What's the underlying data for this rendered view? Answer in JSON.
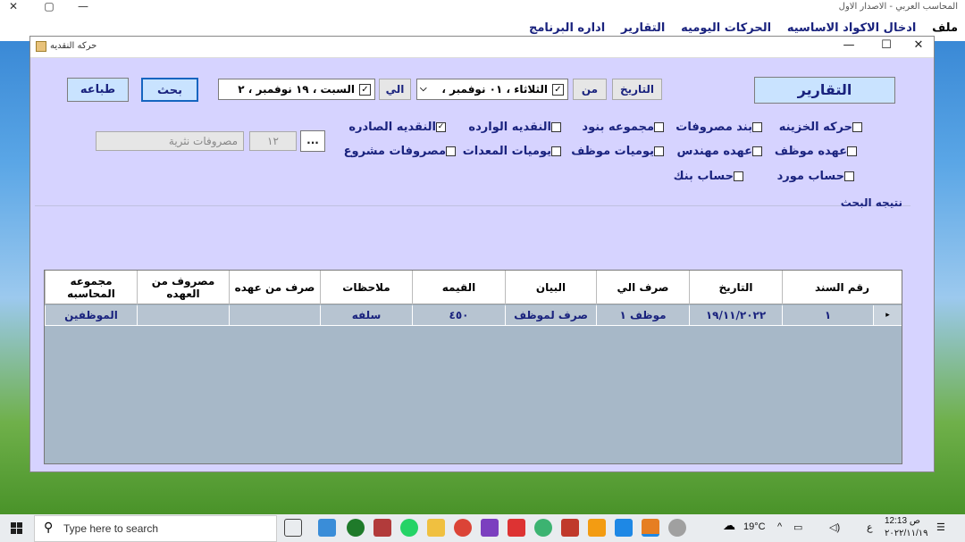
{
  "app": {
    "title": "المحاسب العربي - الاصدار الاول",
    "window_controls": {
      "minimize": "—",
      "maximize": "▢",
      "close": "✕"
    },
    "menu": [
      "ملف",
      "ادخال الاكواد الاساسيه",
      "الحركات اليوميه",
      "التقارير",
      "اداره البرنامج"
    ]
  },
  "dialog": {
    "title": "حركه النقديه",
    "controls": {
      "minimize": "—",
      "maximize": "☐",
      "close": "✕"
    },
    "reports_label": "التقارير",
    "date_label": "التاريخ",
    "from_label": "من",
    "to_label": "الي",
    "date_from": "الثلاثاء ، ٠١ نوفمبر ،",
    "date_to": "السبت ، ١٩ نوفمبر ، ٢",
    "search_button": "بحث",
    "print_button": "طباعه",
    "ellipsis_button": "...",
    "code_value": "١٢",
    "code_name": "مصروفات نثرية",
    "checkboxes": [
      {
        "label": "حركه الخزينه",
        "checked": false
      },
      {
        "label": "بند مصروفات",
        "checked": false
      },
      {
        "label": "مجموعه بنود",
        "checked": false
      },
      {
        "label": "النقديه الوارده",
        "checked": false
      },
      {
        "label": "النقديه الصادره",
        "checked": true
      },
      {
        "label": "عهده موظف",
        "checked": false
      },
      {
        "label": "عهده مهندس",
        "checked": false
      },
      {
        "label": "يوميات موظف",
        "checked": false
      },
      {
        "label": "يوميات المعدات",
        "checked": false
      },
      {
        "label": "مصروفات مشروع",
        "checked": false
      },
      {
        "label": "حساب مورد",
        "checked": false
      },
      {
        "label": "حساب بنك",
        "checked": false
      }
    ],
    "result_label": "نتيجه البحث",
    "grid": {
      "columns": [
        "رقم السند",
        "التاريخ",
        "صرف الي",
        "البيان",
        "القيمه",
        "ملاحظات",
        "صرف من عهده",
        "مصروف من العهده",
        "مجموعه المحاسبه"
      ],
      "rows": [
        [
          "١",
          "١٩/١١/٢٠٢٢",
          "موظف ١",
          "صرف لموظف",
          "٤٥٠",
          "سلفه",
          "",
          "",
          "الموظفين"
        ]
      ],
      "row_indicator": "▸"
    }
  },
  "taskbar": {
    "search_placeholder": "Type here to search",
    "weather": "19°C",
    "lang": "ع",
    "time": "12:13 ص",
    "date": "٢٠٢٢/١١/١٩"
  }
}
